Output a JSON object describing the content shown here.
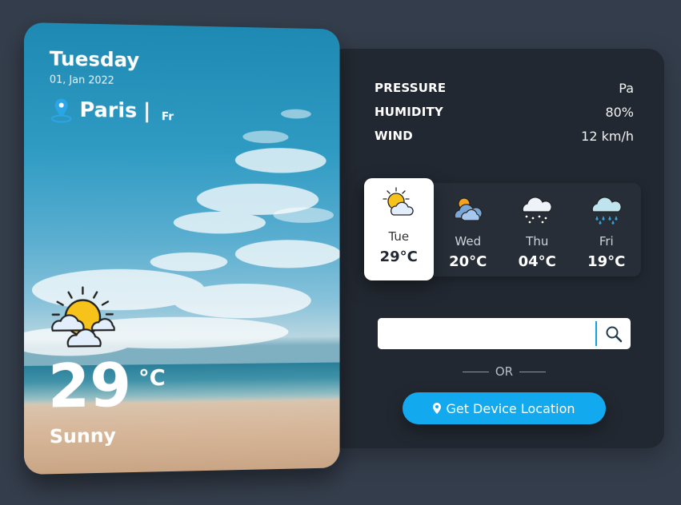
{
  "card": {
    "weekday": "Tuesday",
    "date": "01, Jan 2022",
    "city": "Paris",
    "separator": "|",
    "country": "Fr",
    "temperature": "29",
    "unit": "°C",
    "description": "Sunny",
    "icon": "sun-behind-cloud-icon"
  },
  "stats": [
    {
      "label": "PRESSURE",
      "value": "Pa"
    },
    {
      "label": "HUMIDITY",
      "value": "80%"
    },
    {
      "label": "WIND",
      "value": "12 km/h"
    }
  ],
  "forecast": [
    {
      "day": "Tue",
      "temp": "29°C",
      "icon": "sun-behind-cloud-icon",
      "active": true
    },
    {
      "day": "Wed",
      "temp": "20°C",
      "icon": "cloudy-sun-icon",
      "active": false
    },
    {
      "day": "Thu",
      "temp": "04°C",
      "icon": "snow-cloud-icon",
      "active": false
    },
    {
      "day": "Fri",
      "temp": "19°C",
      "icon": "rain-cloud-icon",
      "active": false
    }
  ],
  "search": {
    "placeholder": "",
    "value": ""
  },
  "or_text": "OR",
  "location_button": "Get Device Location",
  "colors": {
    "page_bg": "#343d4b",
    "panel_bg": "#222831",
    "accent": "#12a9ee",
    "sun": "#f7c31b"
  }
}
